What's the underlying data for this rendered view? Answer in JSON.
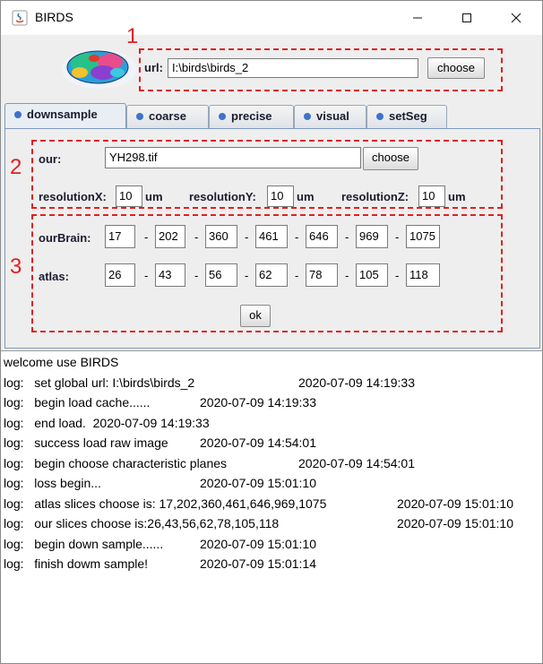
{
  "window": {
    "title": "BIRDS",
    "minimize_glyph": "—",
    "maximize_glyph": "☐",
    "close_glyph": "✕",
    "icon": "java-app-icon"
  },
  "annotations": {
    "one": "1",
    "two": "2",
    "three": "3"
  },
  "url_section": {
    "label": "url:",
    "value": "I:\\birds\\birds_2",
    "choose_label": "choose"
  },
  "tabs": [
    {
      "label": "downsample",
      "active": true
    },
    {
      "label": "coarse",
      "active": false
    },
    {
      "label": "precise",
      "active": false
    },
    {
      "label": "visual",
      "active": false
    },
    {
      "label": "setSeg",
      "active": false
    }
  ],
  "downsample": {
    "our_label": "our:",
    "our_value": "YH298.tif",
    "choose_label": "choose",
    "resolutionX_label": "resolutionX:",
    "resolutionX_value": "10",
    "resolutionY_label": "resolutionY:",
    "resolutionY_value": "10",
    "resolutionZ_label": "resolutionZ:",
    "resolutionZ_value": "10",
    "unit": "um",
    "ourBrain_label": "ourBrain:",
    "ourBrain_values": [
      "17",
      "202",
      "360",
      "461",
      "646",
      "969",
      "1075"
    ],
    "atlas_label": "atlas:",
    "atlas_values": [
      "26",
      "43",
      "56",
      "62",
      "78",
      "105",
      "118"
    ],
    "separator": "-",
    "ok_label": "ok"
  },
  "log": {
    "lines": [
      {
        "text": "welcome use BIRDS",
        "time": ""
      },
      {
        "text": "log:   set global url: I:\\birds\\birds_2",
        "time": "2020-07-09 14:19:33"
      },
      {
        "text": "log:   begin load cache......",
        "time": "2020-07-09 14:19:33"
      },
      {
        "text": "log:   end load.  2020-07-09 14:19:33",
        "time": ""
      },
      {
        "text": "log:   success load raw image",
        "time": "2020-07-09 14:54:01"
      },
      {
        "text": "log:   begin choose characteristic planes",
        "time": "2020-07-09 14:54:01"
      },
      {
        "text": "log:   loss begin...",
        "time": "2020-07-09 15:01:10"
      },
      {
        "text": "log:   atlas slices choose is: 17,202,360,461,646,969,1075",
        "time": "2020-07-09 15:01:10"
      },
      {
        "text": "log:   our slices choose is:26,43,56,62,78,105,118",
        "time": "2020-07-09 15:01:10"
      },
      {
        "text": "log:   begin down sample......",
        "time": "2020-07-09 15:01:10"
      },
      {
        "text": "log:   finish dowm sample!",
        "time": "2020-07-09 15:01:14"
      }
    ]
  },
  "colors": {
    "annotation_red": "#e02020",
    "tab_dot": "#3d73c9",
    "panel_border": "#7f99bb"
  }
}
